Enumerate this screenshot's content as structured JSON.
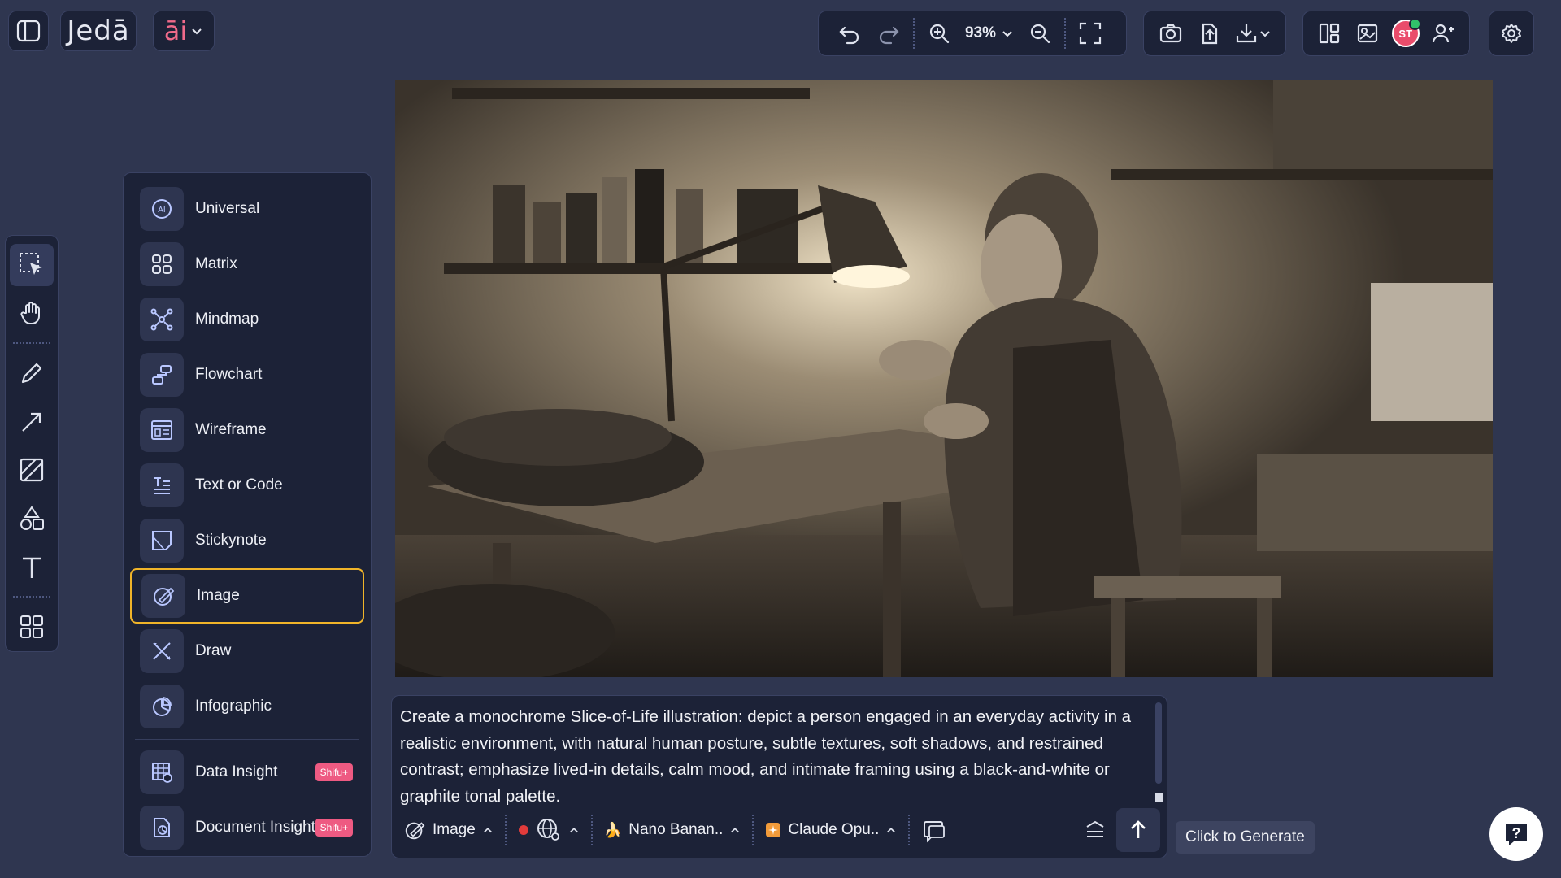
{
  "app": {
    "logo": "Jedā",
    "ai_menu_label": "āi"
  },
  "toolbar": {
    "zoom_level": "93%"
  },
  "user": {
    "initials": "ST",
    "status_color": "#31c26a",
    "avatar_color": "#ea4c6b"
  },
  "left_tools": [
    {
      "name": "select",
      "icon": "select-cursor-icon",
      "active": true
    },
    {
      "name": "pan",
      "icon": "hand-icon"
    },
    {
      "name": "pen",
      "icon": "pencil-icon"
    },
    {
      "name": "arrow",
      "icon": "arrow-icon"
    },
    {
      "name": "frame",
      "icon": "frame-icon"
    },
    {
      "name": "shapes",
      "icon": "shapes-icon"
    },
    {
      "name": "text",
      "icon": "text-icon"
    },
    {
      "name": "apps",
      "icon": "grid-icon"
    }
  ],
  "templates": [
    {
      "label": "Universal",
      "icon": "ai-circle-icon"
    },
    {
      "label": "Matrix",
      "icon": "matrix-icon"
    },
    {
      "label": "Mindmap",
      "icon": "mindmap-icon"
    },
    {
      "label": "Flowchart",
      "icon": "flowchart-icon"
    },
    {
      "label": "Wireframe",
      "icon": "wireframe-icon"
    },
    {
      "label": "Text or Code",
      "icon": "text-code-icon"
    },
    {
      "label": "Stickynote",
      "icon": "stickynote-icon"
    },
    {
      "label": "Image",
      "icon": "image-brush-icon",
      "selected": true
    },
    {
      "label": "Draw",
      "icon": "draw-icon"
    },
    {
      "label": "Infographic",
      "icon": "infographic-icon"
    },
    {
      "label": "Data Insight",
      "icon": "data-insight-icon",
      "badge": "Shifu+"
    },
    {
      "label": "Document Insight",
      "icon": "document-insight-icon",
      "badge": "Shifu+"
    }
  ],
  "prompt": {
    "text": "Create a monochrome Slice-of-Life illustration: depict a person engaged in an everyday activity in a realistic environment, with natural human posture, subtle textures, soft shadows, and restrained contrast; emphasize lived-in details, calm mood, and intimate framing using a black-and-white or graphite tonal palette.",
    "mode_label": "Image",
    "image_model_label": "Nano Banan..",
    "text_model_label": "Claude Opu..",
    "record_color": "#e23b3b"
  },
  "generate_tooltip": "Click to Generate",
  "accent_color": "#f0b429"
}
